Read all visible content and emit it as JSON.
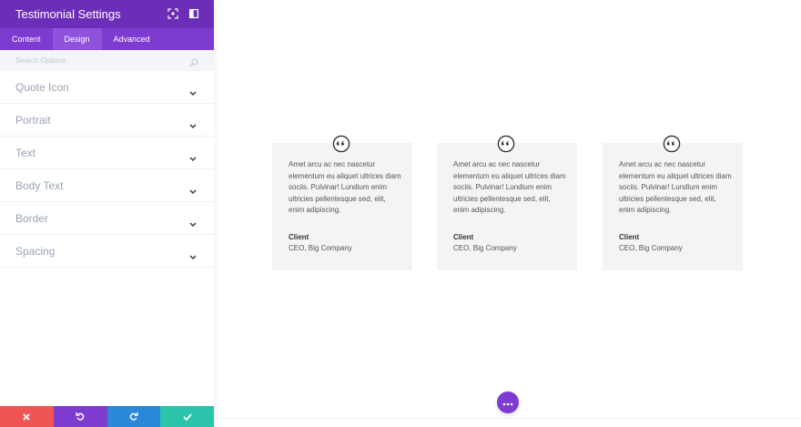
{
  "panel": {
    "title": "Testimonial Settings",
    "tabs": [
      {
        "label": "Content",
        "active": false
      },
      {
        "label": "Design",
        "active": true
      },
      {
        "label": "Advanced",
        "active": false
      }
    ],
    "search": {
      "placeholder": "Search Options"
    },
    "groups": [
      {
        "label": "Quote Icon"
      },
      {
        "label": "Portrait"
      },
      {
        "label": "Text"
      },
      {
        "label": "Body Text"
      },
      {
        "label": "Border"
      },
      {
        "label": "Spacing"
      }
    ],
    "footer": {
      "buttons": [
        "discard-icon",
        "undo-icon",
        "redo-icon",
        "save-check-icon"
      ]
    }
  },
  "preview": {
    "testimonials": [
      {
        "body": "Amet arcu ac nec nascetur elementum eu aliquet ultrices diam sociis. Pulvinar! Lundium enim ultricies pellentesque sed, elit, enim adipiscing.",
        "author": "Client",
        "position": "CEO, Big Company"
      },
      {
        "body": "Amet arcu ac nec nascetur elementum eu aliquet ultrices diam sociis. Pulvinar! Lundium enim ultricies pellentesque sed, elit, enim adipiscing.",
        "author": "Client",
        "position": "CEO, Big Company"
      },
      {
        "body": "Amet arcu ac nec nascetur elementum eu aliquet ultrices diam sociis. Pulvinar! Lundium enim ultricies pellentesque sed, elit, enim adipiscing.",
        "author": "Client",
        "position": "CEO, Big Company"
      }
    ]
  },
  "colors": {
    "header": "#6c2eb9",
    "tabs": "#7e3bd0",
    "tab_active": "#8f52dc",
    "discard": "#ef5555",
    "undo": "#7e3bd0",
    "redo": "#2b87da",
    "save": "#29c4a9",
    "card_bg": "#f4f4f4"
  }
}
